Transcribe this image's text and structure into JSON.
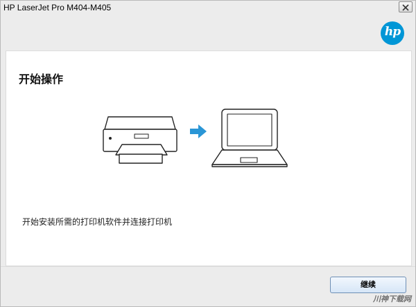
{
  "window": {
    "title": "HP LaserJet Pro M404-M405"
  },
  "brand": {
    "logo_text": "hp",
    "color": "#0096d6"
  },
  "page": {
    "heading": "开始操作",
    "description": "开始安装所需的打印机软件并连接打印机"
  },
  "illustration": {
    "icons": [
      "printer-icon",
      "arrow-right-icon",
      "laptop-icon"
    ],
    "arrow_color": "#2a96d6"
  },
  "footer": {
    "continue_label": "继续"
  },
  "watermark": {
    "text": "川神下载网"
  }
}
